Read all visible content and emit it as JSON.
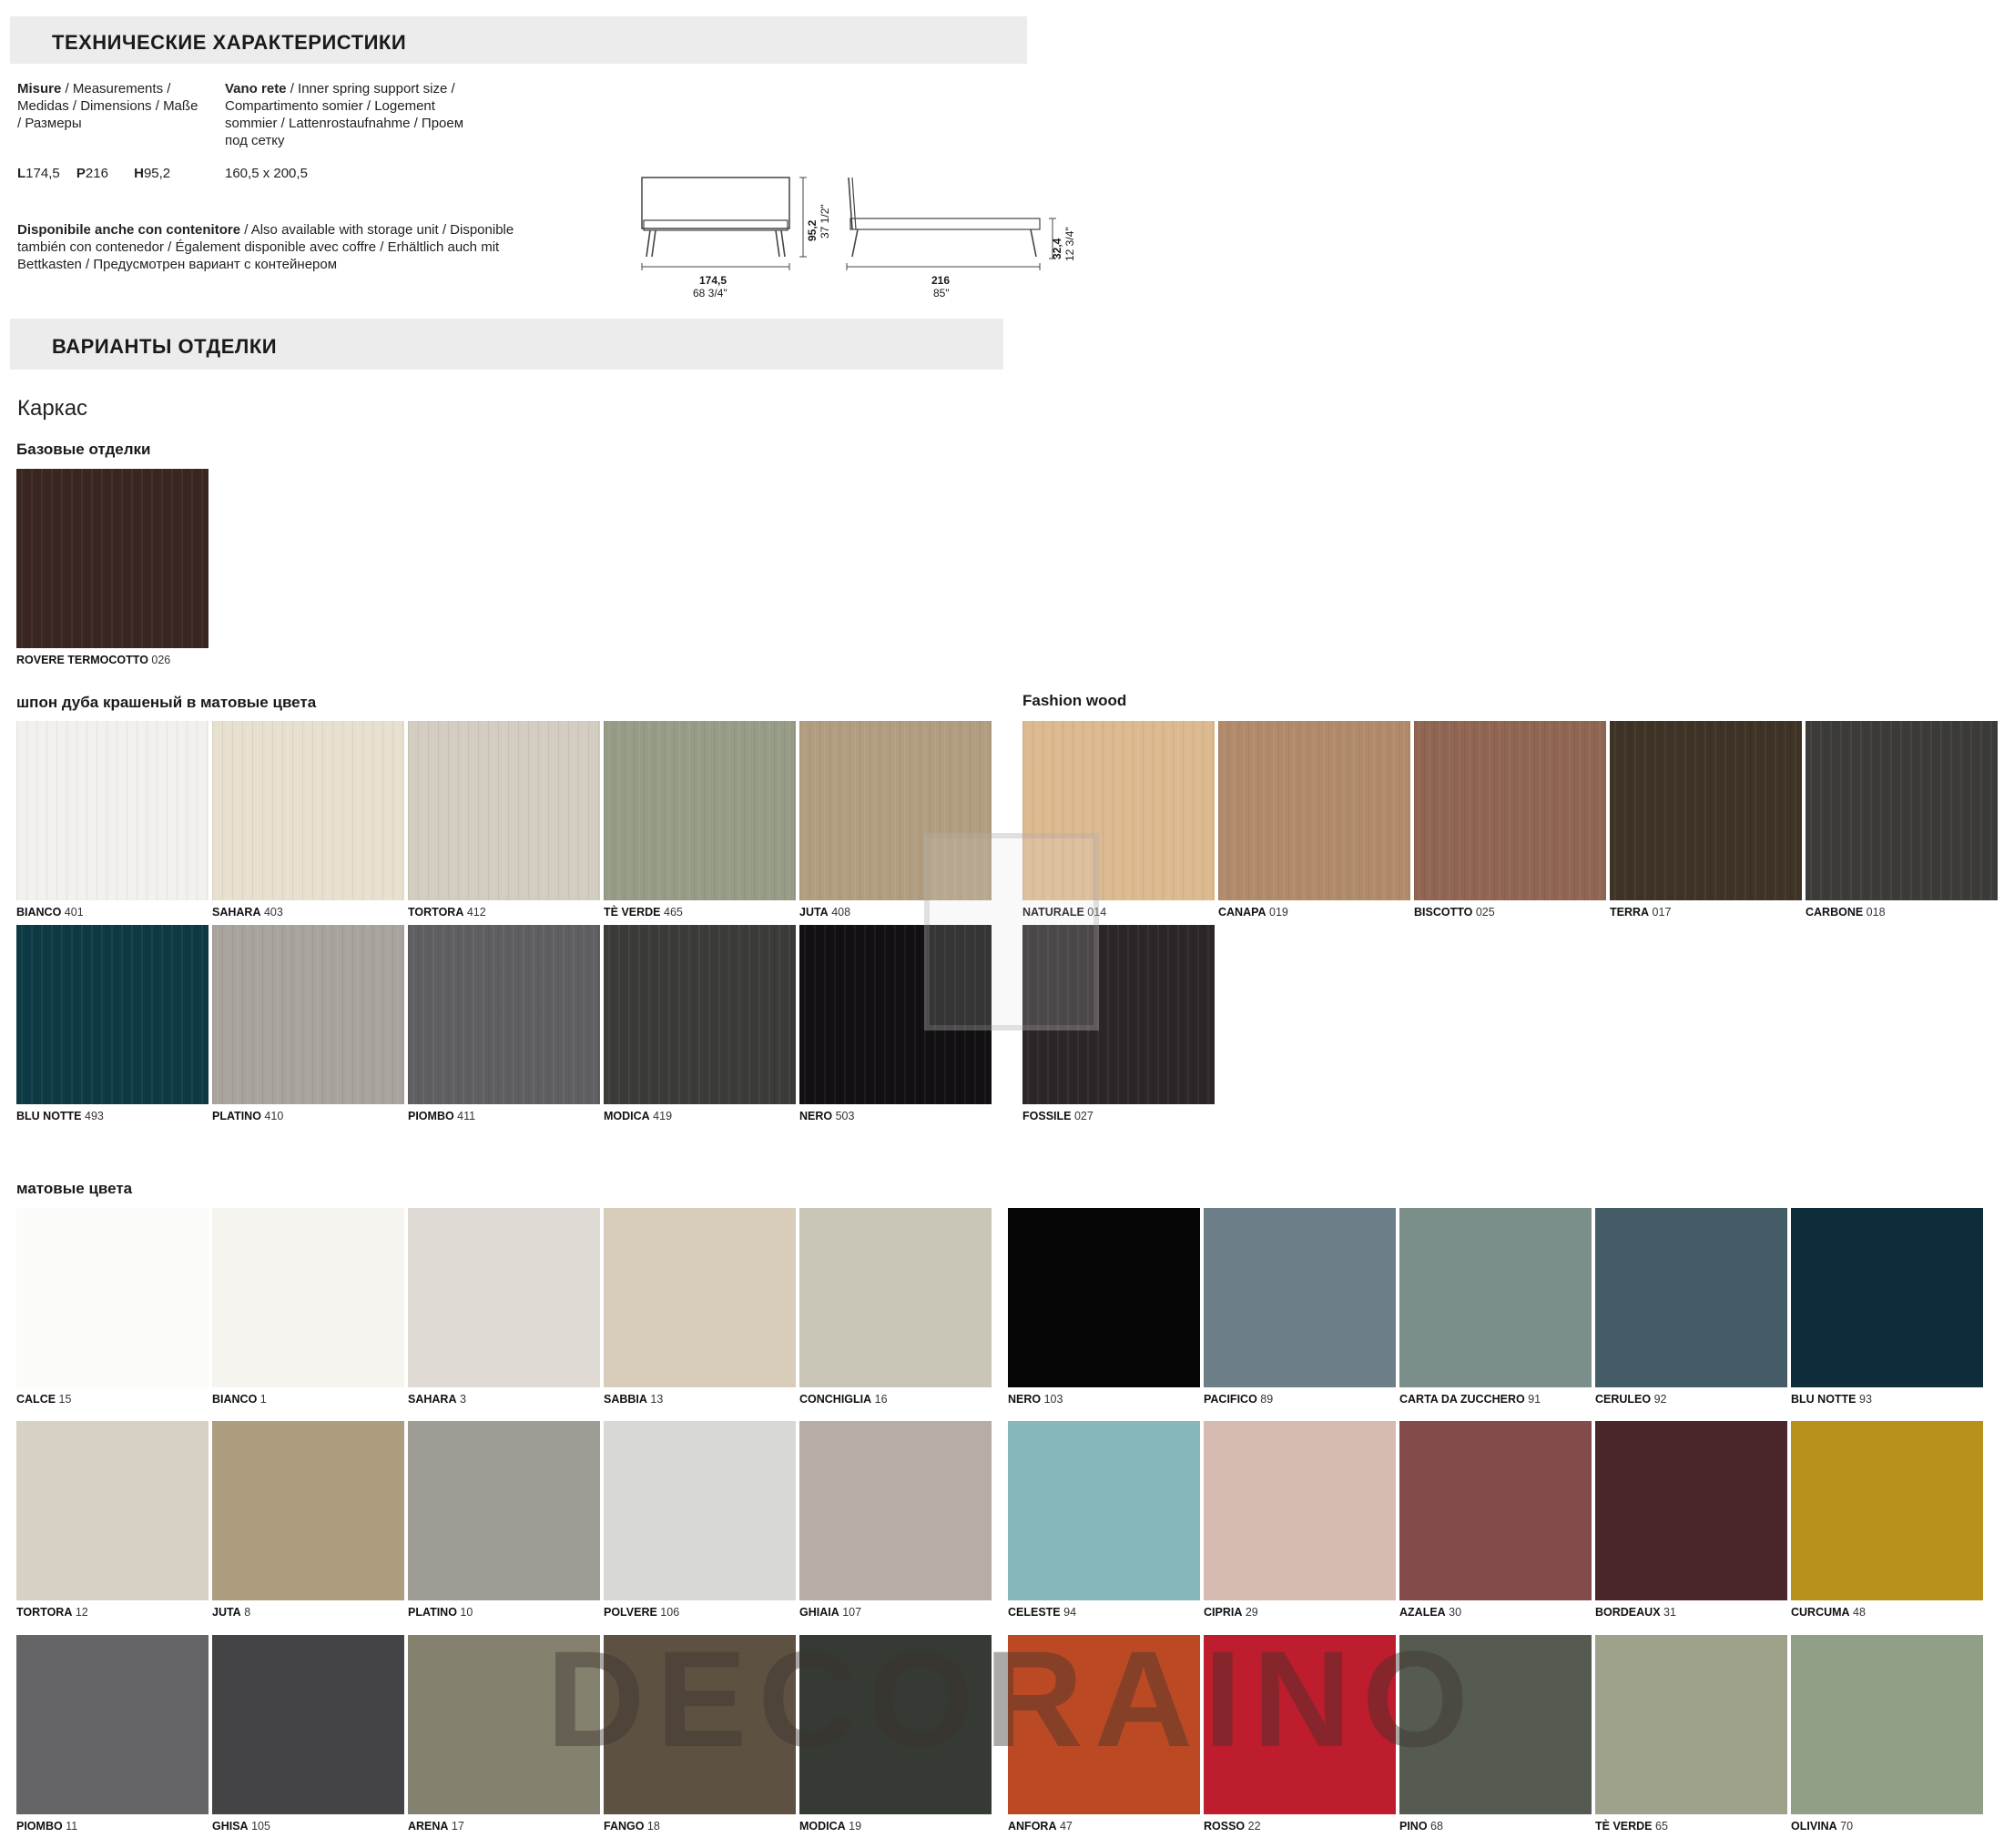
{
  "specs_heading": "ТЕХНИЧЕСКИЕ ХАРАКТЕРИСТИКИ",
  "measurements": {
    "label_bold": "Misure",
    "label_rest": " / Measurements / Medidas / Dimensions / Maße / Размеры",
    "L_prefix": "L",
    "L": "174,5",
    "P_prefix": "P",
    "P": "216",
    "H_prefix": "H",
    "H": "95,2"
  },
  "spring": {
    "label_bold": "Vano rete",
    "label_rest": " / Inner spring support size / Compartimento somier / Logement sommier / Lattenrostaufnahme / Проем под сетку",
    "value": "160,5 x 200,5"
  },
  "storage": {
    "label_bold": "Disponibile anche con contenitore",
    "label_rest": " / Also available with storage unit / Disponible también con contenedor / Également disponible avec coffre / Erhältlich auch mit Bettkasten / Предусмотрен вариант с контейнером"
  },
  "drawing": {
    "front_width": "174,5",
    "front_width_in": "68 3/4\"",
    "height": "95,2",
    "height_in": "37 1/2\"",
    "side_length": "216",
    "side_length_in": "85\"",
    "side_height": "32,4",
    "side_height_in": "12 3/4\""
  },
  "finishes_heading": "ВАРИАНТЫ ОТДЕЛКИ",
  "frame_title": "Каркас",
  "base_title": "Базовые отделки",
  "base_swatch": {
    "name": "ROVERE TERMOCOTTO",
    "code": "026",
    "color": "#3a2620"
  },
  "oak_title": "шпон дуба крашеный в матовые цвета",
  "oak": [
    {
      "name": "BIANCO",
      "code": "401",
      "color": "#f2f0ec"
    },
    {
      "name": "SAHARA",
      "code": "403",
      "color": "#e8e0cf"
    },
    {
      "name": "TORTORA",
      "code": "412",
      "color": "#d3ccc0"
    },
    {
      "name": "TÈ VERDE",
      "code": "465",
      "color": "#969c86"
    },
    {
      "name": "JUTA",
      "code": "408",
      "color": "#b19d80"
    },
    {
      "name": "BLU NOTTE",
      "code": "493",
      "color": "#0e3a45"
    },
    {
      "name": "PLATINO",
      "code": "410",
      "color": "#a8a39c"
    },
    {
      "name": "PIOMBO",
      "code": "411",
      "color": "#5f5f61"
    },
    {
      "name": "MODICA",
      "code": "419",
      "color": "#3b3c39"
    },
    {
      "name": "NERO",
      "code": "503",
      "color": "#121012"
    }
  ],
  "fashion_title": "Fashion wood",
  "fashion": [
    {
      "name": "NATURALE",
      "code": "014",
      "color": "#dcb98e"
    },
    {
      "name": "CANAPA",
      "code": "019",
      "color": "#b08a6a"
    },
    {
      "name": "BISCOTTO",
      "code": "025",
      "color": "#906552"
    },
    {
      "name": "TERRA",
      "code": "017",
      "color": "#3f3326"
    },
    {
      "name": "CARBONE",
      "code": "018",
      "color": "#3c3b38"
    },
    {
      "name": "FOSSILE",
      "code": "027",
      "color": "#2c2628"
    }
  ],
  "matte_title": "матовые цвета",
  "matte": [
    {
      "name": "CALCE",
      "code": "15",
      "color": "#fbfbf9"
    },
    {
      "name": "BIANCO",
      "code": "1",
      "color": "#f5f4ee"
    },
    {
      "name": "SAHARA",
      "code": "3",
      "color": "#dfdbd4"
    },
    {
      "name": "SABBIA",
      "code": "13",
      "color": "#d8ccba"
    },
    {
      "name": "CONCHIGLIA",
      "code": "16",
      "color": "#c9c5b7"
    },
    {
      "name": "NERO",
      "code": "103",
      "color": "#050505"
    },
    {
      "name": "PACIFICO",
      "code": "89",
      "color": "#6c7f88"
    },
    {
      "name": "CARTA DA ZUCCHERO",
      "code": "91",
      "color": "#7a8f8a"
    },
    {
      "name": "CERULEO",
      "code": "92",
      "color": "#445c66"
    },
    {
      "name": "BLU NOTTE",
      "code": "93",
      "color": "#0d2d3a"
    },
    {
      "name": "TORTORA",
      "code": "12",
      "color": "#d6d1c4"
    },
    {
      "name": "JUTA",
      "code": "8",
      "color": "#ae9c7f"
    },
    {
      "name": "PLATINO",
      "code": "10",
      "color": "#9d9d95"
    },
    {
      "name": "POLVERE",
      "code": "106",
      "color": "#d8d8d4"
    },
    {
      "name": "GHIAIA",
      "code": "107",
      "color": "#b6ada6"
    },
    {
      "name": "CELESTE",
      "code": "94",
      "color": "#86b7b9"
    },
    {
      "name": "CIPRIA",
      "code": "29",
      "color": "#d6bbb1"
    },
    {
      "name": "AZALEA",
      "code": "30",
      "color": "#844b4d"
    },
    {
      "name": "BORDEAUX",
      "code": "31",
      "color": "#4a252a"
    },
    {
      "name": "CURCUMA",
      "code": "48",
      "color": "#b8901c"
    },
    {
      "name": "PIOMBO",
      "code": "11",
      "color": "#656567"
    },
    {
      "name": "GHISA",
      "code": "105",
      "color": "#444446"
    },
    {
      "name": "ARENA",
      "code": "17",
      "color": "#84816f"
    },
    {
      "name": "FANGO",
      "code": "18",
      "color": "#5d5242"
    },
    {
      "name": "MODICA",
      "code": "19",
      "color": "#363a35"
    },
    {
      "name": "ANFORA",
      "code": "47",
      "color": "#bb4a24"
    },
    {
      "name": "ROSSO",
      "code": "22",
      "color": "#bd1d2c"
    },
    {
      "name": "PINO",
      "code": "68",
      "color": "#555b51"
    },
    {
      "name": "TÈ VERDE",
      "code": "65",
      "color": "#9fa28a"
    },
    {
      "name": "OLIVINA",
      "code": "70",
      "color": "#919f86"
    }
  ],
  "watermark": "DECORAINO"
}
